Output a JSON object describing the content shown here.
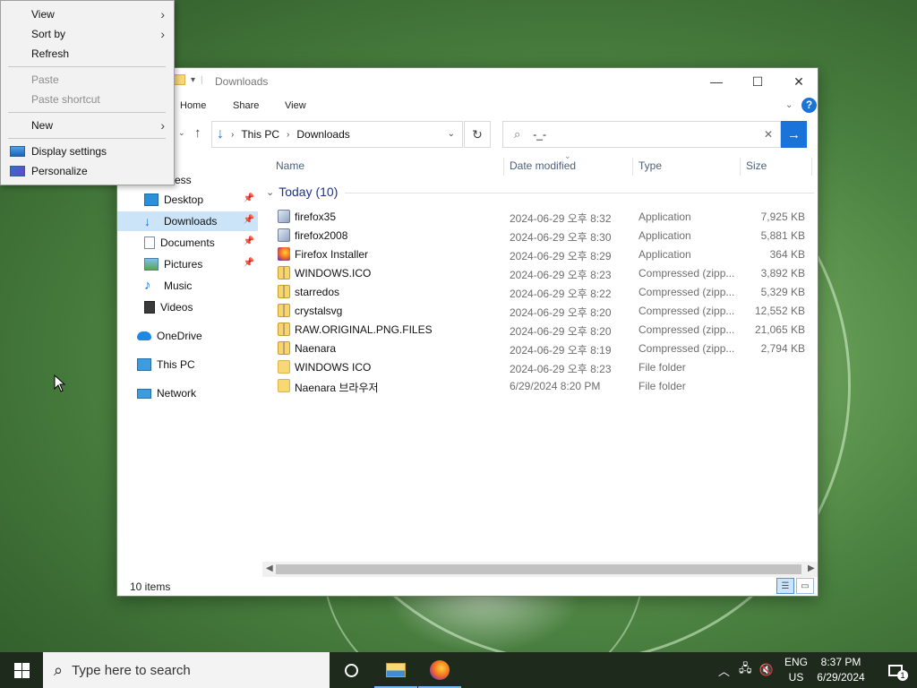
{
  "context_menu": {
    "items": [
      {
        "label": "View",
        "submenu": true,
        "disabled": false
      },
      {
        "label": "Sort by",
        "submenu": true,
        "disabled": false
      },
      {
        "label": "Refresh",
        "submenu": false,
        "disabled": false
      },
      {
        "label": "Paste",
        "submenu": false,
        "disabled": true
      },
      {
        "label": "Paste shortcut",
        "submenu": false,
        "disabled": true
      },
      {
        "label": "New",
        "submenu": true,
        "disabled": false
      },
      {
        "label": "Display settings",
        "submenu": false,
        "disabled": false,
        "icon": "display-icon"
      },
      {
        "label": "Personalize",
        "submenu": false,
        "disabled": false,
        "icon": "personalize-icon"
      }
    ]
  },
  "window": {
    "title": "Downloads",
    "ribbon_tabs": [
      "Home",
      "Share",
      "View"
    ],
    "address": {
      "crumbs": [
        "This PC",
        "Downloads"
      ]
    },
    "search": {
      "value": "-_-"
    }
  },
  "nav_pane": {
    "quick_access_label": "ck access",
    "items": [
      {
        "label": "Desktop",
        "icon": "desktop-icon",
        "pinned": true,
        "selected": false
      },
      {
        "label": "Downloads",
        "icon": "downloads-icon",
        "pinned": true,
        "selected": true
      },
      {
        "label": "Documents",
        "icon": "documents-icon",
        "pinned": true,
        "selected": false
      },
      {
        "label": "Pictures",
        "icon": "pictures-icon",
        "pinned": true,
        "selected": false
      },
      {
        "label": "Music",
        "icon": "music-icon",
        "pinned": false,
        "selected": false
      },
      {
        "label": "Videos",
        "icon": "videos-icon",
        "pinned": false,
        "selected": false
      },
      {
        "label": "OneDrive",
        "icon": "onedrive-icon",
        "pinned": false,
        "selected": false
      },
      {
        "label": "This PC",
        "icon": "this-pc-icon",
        "pinned": false,
        "selected": false
      },
      {
        "label": "Network",
        "icon": "network-icon",
        "pinned": false,
        "selected": false
      }
    ]
  },
  "columns": {
    "name": "Name",
    "date": "Date modified",
    "type": "Type",
    "size": "Size"
  },
  "group_label": "Today (10)",
  "files": [
    {
      "name": "firefox35",
      "date": "2024-06-29 오후 8:32",
      "type": "Application",
      "size": "7,925 KB",
      "icon": "app"
    },
    {
      "name": "firefox2008",
      "date": "2024-06-29 오후 8:30",
      "type": "Application",
      "size": "5,881 KB",
      "icon": "app"
    },
    {
      "name": "Firefox Installer",
      "date": "2024-06-29 오후 8:29",
      "type": "Application",
      "size": "364 KB",
      "icon": "ff"
    },
    {
      "name": "WINDOWS.ICO",
      "date": "2024-06-29 오후 8:23",
      "type": "Compressed (zipp...",
      "size": "3,892 KB",
      "icon": "zip"
    },
    {
      "name": "starredos",
      "date": "2024-06-29 오후 8:22",
      "type": "Compressed (zipp...",
      "size": "5,329 KB",
      "icon": "zip"
    },
    {
      "name": "crystalsvg",
      "date": "2024-06-29 오후 8:20",
      "type": "Compressed (zipp...",
      "size": "12,552 KB",
      "icon": "zip"
    },
    {
      "name": "RAW.ORIGINAL.PNG.FILES",
      "date": "2024-06-29 오후 8:20",
      "type": "Compressed (zipp...",
      "size": "21,065 KB",
      "icon": "zip"
    },
    {
      "name": "Naenara",
      "date": "2024-06-29 오후 8:19",
      "type": "Compressed (zipp...",
      "size": "2,794 KB",
      "icon": "zip"
    },
    {
      "name": "WINDOWS ICO",
      "date": "2024-06-29 오후 8:23",
      "type": "File folder",
      "size": "",
      "icon": "folder"
    },
    {
      "name": "Naenara 브라우저",
      "date": "6/29/2024 8:20 PM",
      "type": "File folder",
      "size": "",
      "icon": "folder"
    }
  ],
  "status_bar": {
    "count": "10 items"
  },
  "taskbar": {
    "search_placeholder": "Type here to search",
    "lang_line1": "ENG",
    "lang_line2": "US",
    "time": "8:37 PM",
    "date": "6/29/2024",
    "notification_count": "1"
  },
  "colors": {
    "accent": "#1a73d9",
    "selection": "#cce4f7",
    "group_header": "#1e3287"
  }
}
